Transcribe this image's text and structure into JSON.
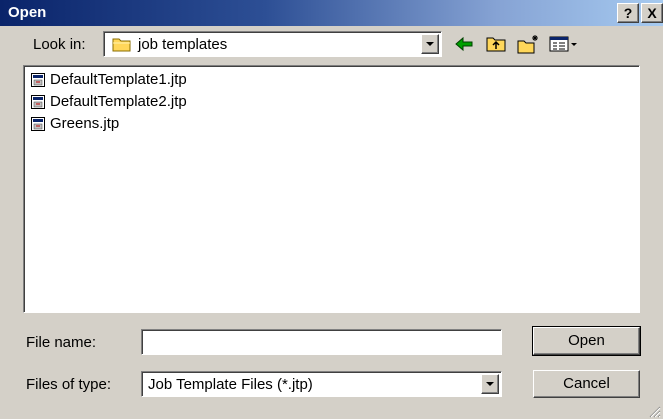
{
  "dialog": {
    "title": "Open",
    "help_button": "?",
    "close_button": "X"
  },
  "look_in": {
    "label": "Look in:",
    "value": "job templates",
    "icon": "folder-icon"
  },
  "toolbar": {
    "icons": [
      "back-arrow-icon",
      "up-folder-icon",
      "new-folder-icon",
      "view-menu-icon"
    ]
  },
  "files": [
    {
      "name": "DefaultTemplate1.jtp",
      "icon": "template-file-icon"
    },
    {
      "name": "DefaultTemplate2.jtp",
      "icon": "template-file-icon"
    },
    {
      "name": "Greens.jtp",
      "icon": "template-file-icon"
    }
  ],
  "file_name": {
    "label": "File name:",
    "value": "",
    "placeholder": ""
  },
  "file_type": {
    "label": "Files of type:",
    "value": "Job Template Files (*.jtp)"
  },
  "buttons": {
    "open_label": "Open",
    "cancel_label": "Cancel"
  },
  "colors": {
    "title_start": "#0a246a",
    "title_end": "#a6caf0",
    "face": "#d4d0c8",
    "folder": "#ffd75a",
    "back_arrow": "#00a000"
  }
}
